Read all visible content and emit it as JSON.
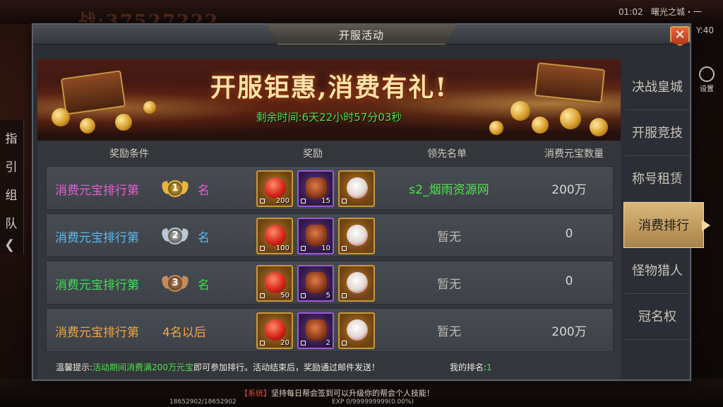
{
  "background": {
    "combat_power": "战:37527222",
    "clock": "01:02",
    "map_name": "曙光之城・一",
    "coord": "Y:40",
    "settings_label": "设置",
    "side_tabs": [
      "指",
      "引",
      "组",
      "队"
    ],
    "system_message_tag": "【系统】",
    "system_message": "坚持每日帮会签到可以升级你的帮会个人技能！",
    "hp_readout": "18652902/18652902",
    "exp_readout": "EXP 0/999999999(0.00%)"
  },
  "dialog": {
    "title": "开服活动",
    "close_icon": "close-icon"
  },
  "banner": {
    "headline": "开服钜惠,消费有礼!",
    "remaining_label": "剩余时间:",
    "remaining_value": "6天22小时57分03秒"
  },
  "table": {
    "headers": {
      "condition": "奖励条件",
      "reward": "奖励",
      "leader": "领先名单",
      "amount": "消费元宝数量"
    },
    "rows": [
      {
        "condition": "消费元宝排行第",
        "rank_text": "1",
        "suffix": "名",
        "text_color": "#e55fd5",
        "medal_color": "#e9b63a",
        "rewards": [
          {
            "type": "red-gem-icon",
            "qty": "200"
          },
          {
            "type": "scroll-icon",
            "qty": "15"
          },
          {
            "type": "pouch-icon",
            "qty": ""
          }
        ],
        "leader": "s2_烟雨资源网",
        "leader_color": "#4fe14d",
        "amount": "200万"
      },
      {
        "condition": "消费元宝排行第",
        "rank_text": "2",
        "suffix": "名",
        "text_color": "#5cb7f2",
        "medal_color": "#b9c7d6",
        "rewards": [
          {
            "type": "red-gem-icon",
            "qty": "100"
          },
          {
            "type": "scroll-icon",
            "qty": "10"
          },
          {
            "type": "pouch-icon",
            "qty": ""
          }
        ],
        "leader": "暂无",
        "leader_color": "#bdb9b1",
        "amount": "0"
      },
      {
        "condition": "消费元宝排行第",
        "rank_text": "3",
        "suffix": "名",
        "text_color": "#43dd55",
        "medal_color": "#c98a5a",
        "rewards": [
          {
            "type": "red-gem-icon",
            "qty": "50"
          },
          {
            "type": "scroll-icon",
            "qty": "5"
          },
          {
            "type": "pouch-icon",
            "qty": ""
          }
        ],
        "leader": "暂无",
        "leader_color": "#bdb9b1",
        "amount": "0"
      },
      {
        "condition": "消费元宝排行第",
        "rank_after": "4名以后",
        "text_color": "#f0a544",
        "rewards": [
          {
            "type": "red-gem-icon",
            "qty": "20"
          },
          {
            "type": "scroll-icon",
            "qty": "2"
          },
          {
            "type": "pouch-icon",
            "qty": ""
          }
        ],
        "leader": "暂无",
        "leader_color": "#bdb9b1",
        "amount": "200万"
      }
    ]
  },
  "footer": {
    "tip_prefix": "温馨提示:",
    "tip_highlight": "活动期间消费满200万元宝",
    "tip_suffix": "即可参加排行。活动结束后，奖励通过邮件发送！",
    "my_rank_label": "我的排名:",
    "my_rank_value": "1"
  },
  "tabs": [
    {
      "label": "决战皇城",
      "active": false
    },
    {
      "label": "开服竞技",
      "active": false
    },
    {
      "label": "称号租赁",
      "active": false
    },
    {
      "label": "消费排行",
      "active": true
    },
    {
      "label": "怪物猎人",
      "active": false
    },
    {
      "label": "冠名权",
      "active": false
    }
  ]
}
